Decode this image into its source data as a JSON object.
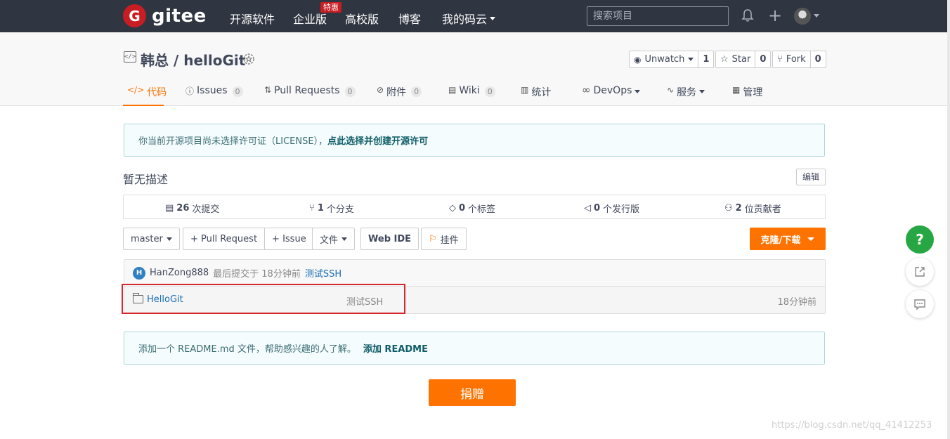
{
  "nav": {
    "logo_mark": "G",
    "logo_text": "gitee",
    "items": [
      {
        "label": "开源软件"
      },
      {
        "label": "企业版"
      },
      {
        "label": "高校版"
      },
      {
        "label": "博客"
      },
      {
        "label": "我的码云"
      }
    ],
    "hot_badge": "特惠",
    "search_placeholder": "搜索项目"
  },
  "project": {
    "title": "韩总 / helloGit",
    "watch": {
      "label": "Unwatch",
      "count": "1"
    },
    "star": {
      "label": "Star",
      "count": "0"
    },
    "fork": {
      "label": "Fork",
      "count": "0"
    }
  },
  "tabs": [
    {
      "icon": "</>",
      "label": "代码"
    },
    {
      "icon": "ⓘ",
      "label": "Issues",
      "count": "0"
    },
    {
      "icon": "⇅",
      "label": "Pull Requests",
      "count": "0"
    },
    {
      "icon": "⊘",
      "label": "附件",
      "count": "0"
    },
    {
      "icon": "▤",
      "label": "Wiki",
      "count": "0"
    },
    {
      "icon": "▥",
      "label": "统计"
    },
    {
      "icon": "∞",
      "label": "DevOps"
    },
    {
      "icon": "∿",
      "label": "服务"
    },
    {
      "icon": "▦",
      "label": "管理"
    }
  ],
  "license": {
    "text": "你当前开源项目尚未选择许可证（LICENSE），",
    "link": "点此选择并创建开源许可"
  },
  "description": "暂无描述",
  "edit_label": "编辑",
  "stats": [
    {
      "num": "26",
      "label": "次提交"
    },
    {
      "num": "1",
      "label": "个分支"
    },
    {
      "num": "0",
      "label": "个标签"
    },
    {
      "num": "0",
      "label": "个发行版"
    },
    {
      "num": "2",
      "label": "位贡献者"
    }
  ],
  "toolbar": {
    "branch": "master",
    "pull_request": "+ Pull Request",
    "issue": "+ Issue",
    "file": "文件",
    "web_ide": "Web IDE",
    "widget": "挂件",
    "clone": "克隆/下载"
  },
  "last_commit": {
    "avatar": "H",
    "author": "HanZong888",
    "meta": "最后提交于 18分钟前",
    "message": "测试SSH"
  },
  "files": [
    {
      "name": "HelloGit",
      "commit": "测试SSH",
      "time": "18分钟前"
    }
  ],
  "readme": {
    "text": "添加一个 README.md 文件，帮助感兴趣的人了解。",
    "link": "添加 README"
  },
  "donate": "捐赠",
  "help": "?",
  "watermark": "https://blog.csdn.net/qq_41412253"
}
